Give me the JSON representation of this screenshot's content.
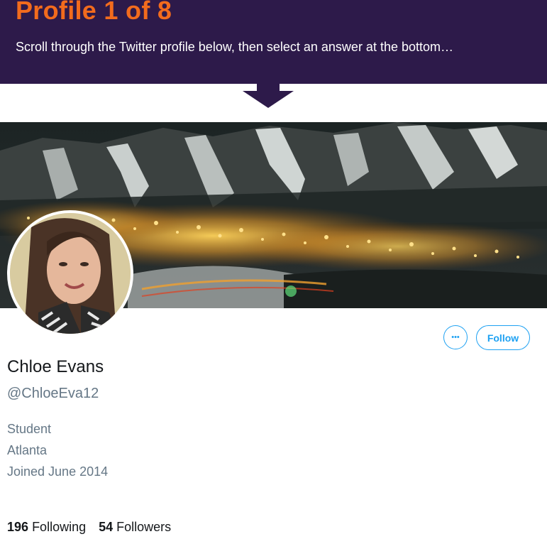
{
  "header": {
    "title": "Profile 1 of 8",
    "subtitle": "Scroll through the Twitter profile below, then select an answer at the bottom…"
  },
  "profile": {
    "name": "Chloe Evans",
    "handle": "@ChloeEva12",
    "bio_lines": [
      "Student",
      "Atlanta",
      "Joined June 2014"
    ],
    "following_count": "196",
    "following_label": "Following",
    "followers_count": "54",
    "followers_label": "Followers"
  },
  "actions": {
    "more_icon": "more-horizontal-icon",
    "more_glyph": "•••",
    "follow_label": "Follow"
  },
  "colors": {
    "header_bg": "#2d1a4a",
    "title_accent": "#f26b1d",
    "twitter_blue": "#1da1f2",
    "secondary_text": "#657786"
  }
}
